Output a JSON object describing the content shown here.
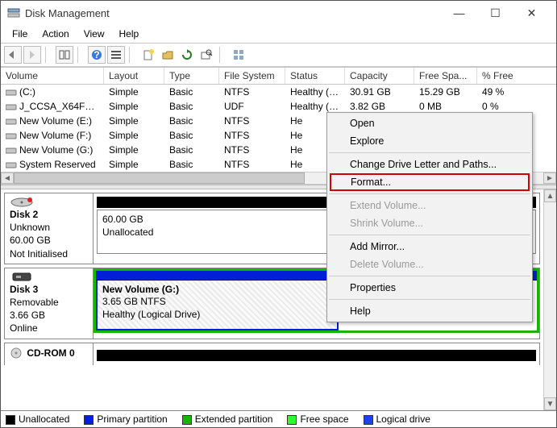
{
  "title": "Disk Management",
  "menu": {
    "file": "File",
    "action": "Action",
    "view": "View",
    "help": "Help"
  },
  "winctl": {
    "min": "—",
    "max": "☐",
    "close": "✕"
  },
  "columns": {
    "volume": "Volume",
    "layout": "Layout",
    "type": "Type",
    "fs": "File System",
    "status": "Status",
    "capacity": "Capacity",
    "free": "Free Spa...",
    "pct": "% Free"
  },
  "volumes": [
    {
      "name": "(C:)",
      "layout": "Simple",
      "type": "Basic",
      "fs": "NTFS",
      "status": "Healthy (B...",
      "cap": "30.91 GB",
      "free": "15.29 GB",
      "pct": "49 %"
    },
    {
      "name": "J_CCSA_X64FRE_E...",
      "layout": "Simple",
      "type": "Basic",
      "fs": "UDF",
      "status": "Healthy (P...",
      "cap": "3.82 GB",
      "free": "0 MB",
      "pct": "0 %"
    },
    {
      "name": "New Volume (E:)",
      "layout": "Simple",
      "type": "Basic",
      "fs": "NTFS",
      "status": "He",
      "cap": "",
      "free": "",
      "pct": ""
    },
    {
      "name": "New Volume (F:)",
      "layout": "Simple",
      "type": "Basic",
      "fs": "NTFS",
      "status": "He",
      "cap": "",
      "free": "",
      "pct": ""
    },
    {
      "name": "New Volume (G:)",
      "layout": "Simple",
      "type": "Basic",
      "fs": "NTFS",
      "status": "He",
      "cap": "",
      "free": "",
      "pct": ""
    },
    {
      "name": "System Reserved",
      "layout": "Simple",
      "type": "Basic",
      "fs": "NTFS",
      "status": "He",
      "cap": "",
      "free": "",
      "pct": ""
    }
  ],
  "disk2": {
    "title": "Disk 2",
    "type": "Unknown",
    "size": "60.00 GB",
    "state": "Not Initialised",
    "box_size": "60.00 GB",
    "box_state": "Unallocated"
  },
  "disk3": {
    "title": "Disk 3",
    "type": "Removable",
    "size": "3.66 GB",
    "state": "Online",
    "vol_name": "New Volume  (G:)",
    "vol_size": "3.65 GB NTFS",
    "vol_status": "Healthy (Logical Drive)"
  },
  "cdrom": {
    "title": "CD-ROM 0"
  },
  "legend": {
    "unalloc": "Unallocated",
    "primary": "Primary partition",
    "extended": "Extended partition",
    "free": "Free space",
    "logical": "Logical drive"
  },
  "context": {
    "open": "Open",
    "explore": "Explore",
    "change": "Change Drive Letter and Paths...",
    "format": "Format...",
    "extend": "Extend Volume...",
    "shrink": "Shrink Volume...",
    "mirror": "Add Mirror...",
    "delete": "Delete Volume...",
    "props": "Properties",
    "help": "Help"
  }
}
